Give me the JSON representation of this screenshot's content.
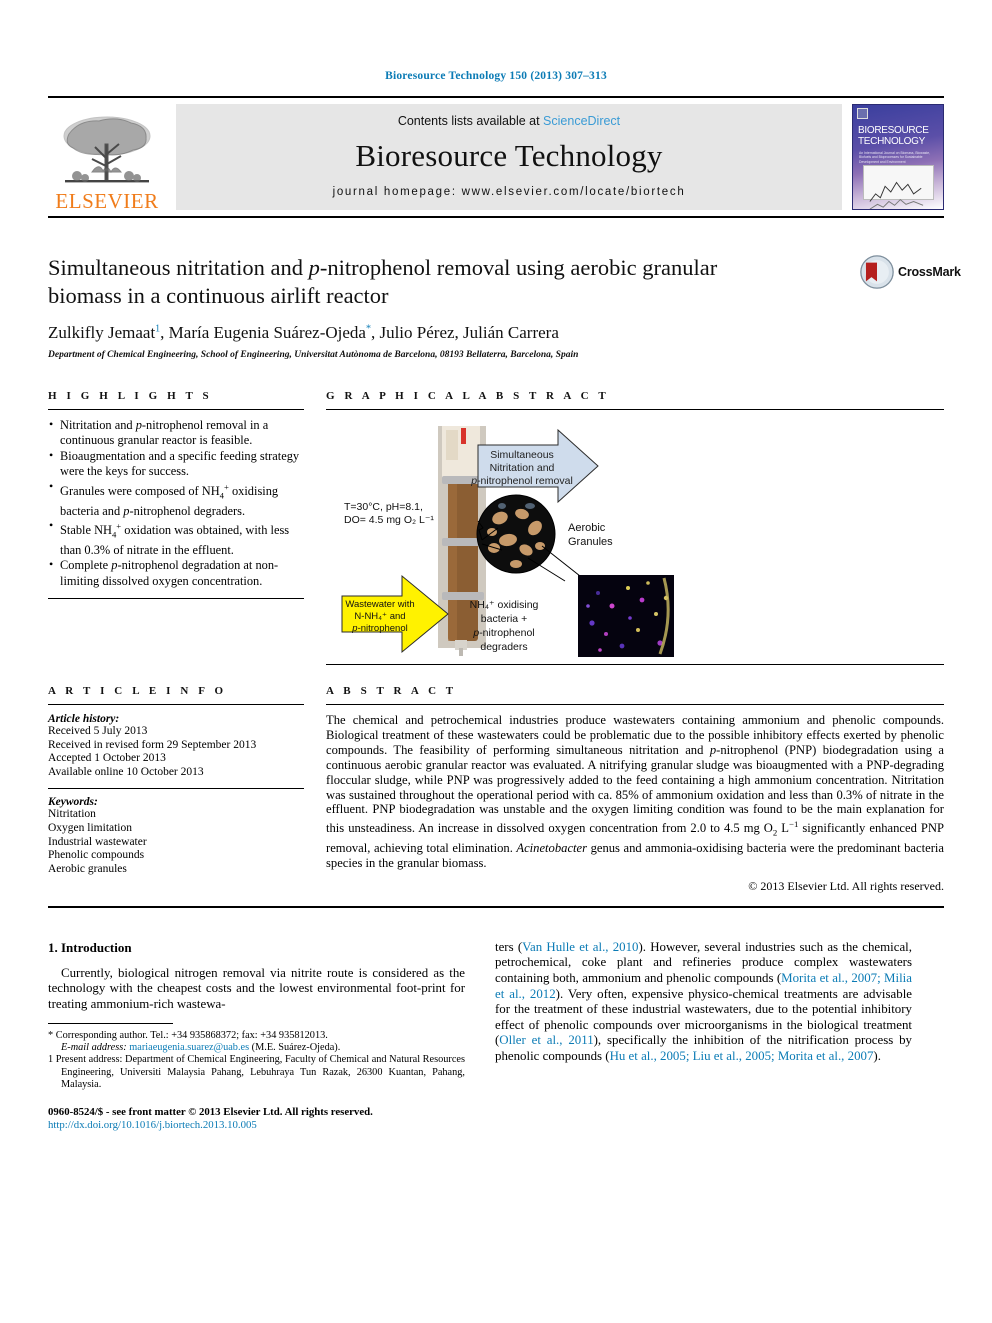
{
  "running_head": "Bioresource Technology 150 (2013) 307–313",
  "masthead": {
    "publisher_name": "ELSEVIER",
    "contents_prefix": "Contents lists available at ",
    "contents_link": "ScienceDirect",
    "journal_name": "Bioresource Technology",
    "homepage": "journal homepage: www.elsevier.com/locate/biortech",
    "cover": {
      "line1": "BIORESOURCE",
      "line2": "TECHNOLOGY",
      "subtitle": "An International Journal on Biomass, Biowaste, Biofuels and Bioprocesses for Sustainable Development and Environment"
    }
  },
  "article": {
    "title_part1": "Simultaneous nitritation and ",
    "title_italic": "p",
    "title_part2": "-nitrophenol removal using aerobic granular biomass in a continuous airlift reactor",
    "authors": [
      {
        "name": "Zulkifly Jemaat",
        "mark": "1"
      },
      {
        "name": "María Eugenia Suárez-Ojeda",
        "mark": "*"
      },
      {
        "name": "Julio Pérez",
        "mark": ""
      },
      {
        "name": "Julián Carrera",
        "mark": ""
      }
    ],
    "affiliation": "Department of Chemical Engineering, School of Engineering, Universitat Autònoma de Barcelona, 08193 Bellaterra, Barcelona, Spain",
    "crossmark_label": "CrossMark"
  },
  "highlights": {
    "heading": "H I G H L I G H T S",
    "items": [
      "Nitritation and <i>p</i>-nitrophenol removal in a continuous granular reactor is feasible.",
      "Bioaugmentation and a specific feeding strategy were the keys for success.",
      "Granules were composed of NH<sub>4</sub><sup>+</sup> oxidising bacteria and <i>p</i>-nitrophenol degraders.",
      "Stable NH<sub>4</sub><sup>+</sup> oxidation was obtained, with less than 0.3% of nitrate in the effluent.",
      "Complete <i>p</i>-nitrophenol degradation at non-limiting dissolved oxygen concentration."
    ]
  },
  "graphical_abstract": {
    "heading": "G R A P H I C A L   A B S T R A C T",
    "conditions_line1": "T=30°C, pH=8.1,",
    "conditions_line2": "DO= 4.5 mg O₂ L⁻¹",
    "arrow_out_line1": "Simultaneous",
    "arrow_out_line2": "Nitritation and",
    "arrow_out_line3": "p-nitrophenol removal",
    "arrow_in_line1": "Wastewater with",
    "arrow_in_line2": "N-NH₄⁺ and",
    "arrow_in_line3": "p-nitrophenol",
    "granules_label_line1": "Aerobic",
    "granules_label_line2": "Granules",
    "fish_label_line1": "NH₄⁺ oxidising",
    "fish_label_line2": "bacteria +",
    "fish_label_line3": "p-nitrophenol",
    "fish_label_line4": "degraders"
  },
  "article_info": {
    "heading": "A R T I C L E   I N F O",
    "history_label": "Article history:",
    "history": [
      "Received 5 July 2013",
      "Received in revised form 29 September 2013",
      "Accepted 1 October 2013",
      "Available online 10 October 2013"
    ],
    "keywords_label": "Keywords:",
    "keywords": [
      "Nitritation",
      "Oxygen limitation",
      "Industrial wastewater",
      "Phenolic compounds",
      "Aerobic granules"
    ]
  },
  "abstract": {
    "heading": "A B S T R A C T",
    "text": "The chemical and petrochemical industries produce wastewaters containing ammonium and phenolic compounds. Biological treatment of these wastewaters could be problematic due to the possible inhibitory effects exerted by phenolic compounds. The feasibility of performing simultaneous nitritation and <i>p</i>-nitrophenol (PNP) biodegradation using a continuous aerobic granular reactor was evaluated. A nitrifying granular sludge was bioaugmented with a PNP-degrading floccular sludge, while PNP was progressively added to the feed containing a high ammonium concentration. Nitritation was sustained throughout the operational period with ca. 85% of ammonium oxidation and less than 0.3% of nitrate in the effluent. PNP biodegradation was unstable and the oxygen limiting condition was found to be the main explanation for this unsteadiness. An increase in dissolved oxygen concentration from 2.0 to 4.5 mg O<sub>2</sub> L<sup>−1</sup> significantly enhanced PNP removal, achieving total elimination. <i>Acinetobacter</i> genus and ammonia-oxidising bacteria were the predominant bacteria species in the granular biomass.",
    "copyright": "© 2013 Elsevier Ltd. All rights reserved."
  },
  "introduction": {
    "heading": "1. Introduction",
    "paragraph_left": "Currently, biological nitrogen removal via nitrite route is considered as the technology with the cheapest costs and the lowest environmental foot-print for treating ammonium-rich wastewa-",
    "paragraph_right_pre": "ters (",
    "citations": [
      "Van Hulle et al., 2010",
      "Morita et al., 2007; Milia et al., 2012",
      "Oller et al., 2011",
      "Hu et al., 2005; Liu et al., 2005; Morita et al., 2007"
    ],
    "paragraph_right": "ters (<span class='cite'>Van Hulle et al., 2010</span>). However, several industries such as the chemical, petrochemical, coke plant and refineries produce complex wastewaters containing both, ammonium and phenolic compounds (<span class='cite'>Morita et al., 2007; Milia et al., 2012</span>). Very often, expensive physico-chemical treatments are advisable for the treatment of these industrial wastewaters, due to the potential inhibitory effect of phenolic compounds over microorganisms in the biological treatment (<span class='cite'>Oller et al., 2011</span>), specifically the inhibition of the nitrification process by phenolic compounds (<span class='cite'>Hu et al., 2005; Liu et al., 2005; Morita et al., 2007</span>)."
  },
  "footnotes": {
    "corresponding": "* Corresponding author. Tel.: +34 935868372; fax: +34 935812013.",
    "email_label": "E-mail address:",
    "email": "mariaeugenia.suarez@uab.es",
    "email_owner": "(M.E. Suárez-Ojeda).",
    "present_address": "1 Present address: Department of Chemical Engineering, Faculty of Chemical and Natural Resources Engineering, Universiti Malaysia Pahang, Lebuhraya Tun Razak, 26300 Kuantan, Pahang, Malaysia."
  },
  "footer": {
    "issn_line": "0960-8524/$ - see front matter © 2013 Elsevier Ltd. All rights reserved.",
    "doi": "http://dx.doi.org/10.1016/j.biortech.2013.10.005"
  },
  "colors": {
    "link_blue": "#0b7bb5",
    "sciencedirect_blue": "#3a9bd5",
    "elsevier_orange": "#f07c1a",
    "arrow_blue": "#cfdcec",
    "arrow_yellow": "#fff200"
  }
}
